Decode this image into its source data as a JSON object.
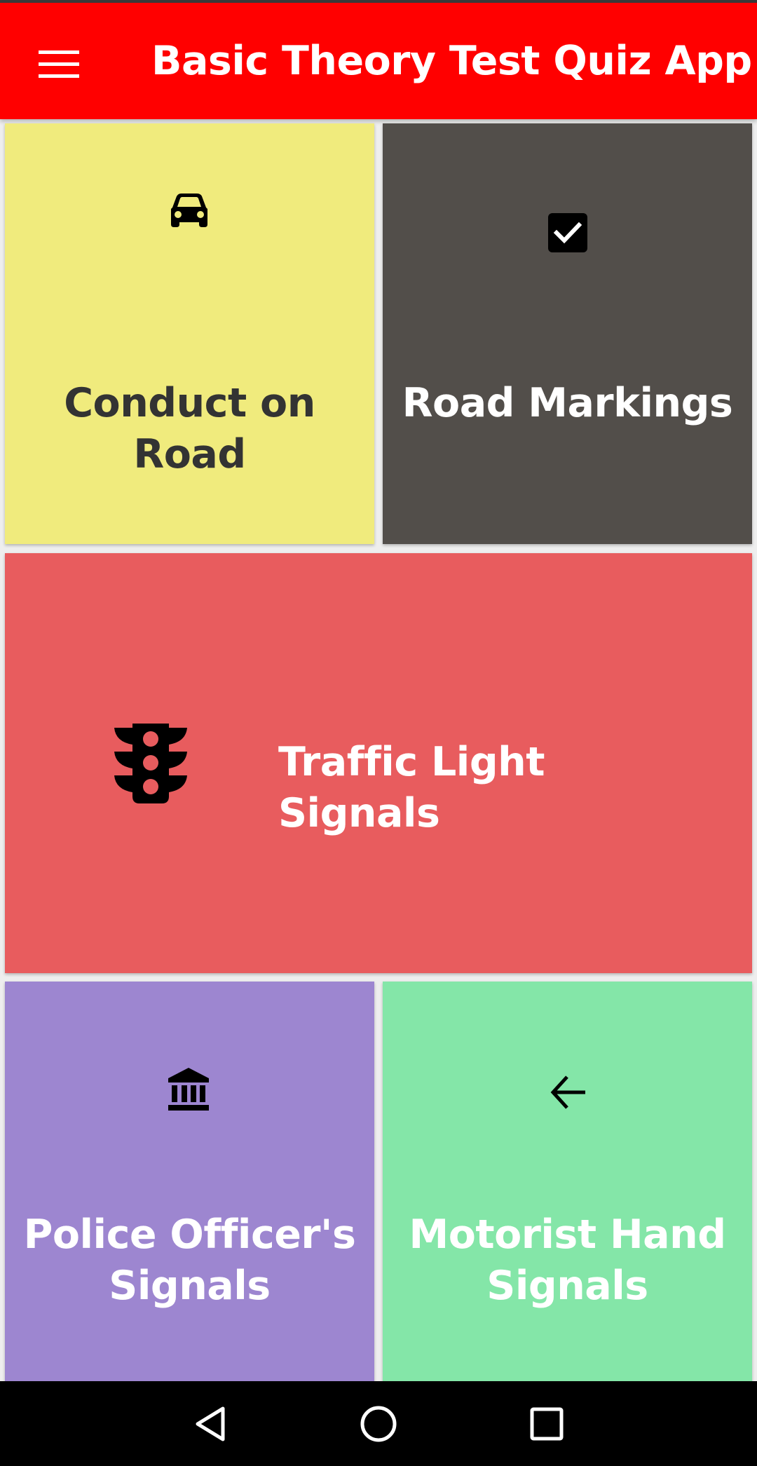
{
  "app_bar": {
    "title": "Basic Theory Test Quiz App",
    "menu_icon": "hamburger-menu-icon",
    "background": "#ff0000"
  },
  "tiles": [
    {
      "label": "Conduct on Road",
      "icon": "car-icon",
      "color": "#f0eb7d"
    },
    {
      "label": "Road Markings",
      "icon": "checkbox-checked-icon",
      "color": "#524e4a"
    },
    {
      "label": "Traffic Light Signals",
      "icon": "traffic-light-icon",
      "color": "#e85c5e"
    },
    {
      "label_lines": [
        "Police Officer's",
        "Signals"
      ],
      "icon": "bank-building-icon",
      "color": "#9d86d0"
    },
    {
      "label_lines": [
        "Motorist Hand",
        "Signals"
      ],
      "icon": "arrow-left-icon",
      "color": "#84e6a8"
    }
  ],
  "nav_bar": {
    "back_icon": "nav-back-triangle-icon",
    "home_icon": "nav-home-circle-icon",
    "recents_icon": "nav-recents-square-icon"
  }
}
